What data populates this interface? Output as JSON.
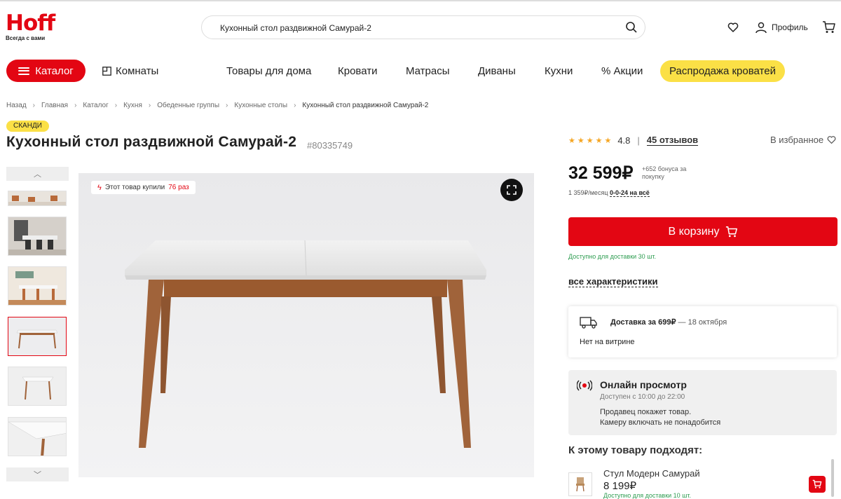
{
  "brand": {
    "logo": "Hoff",
    "tagline": "Всегда с вами",
    "accent": "#e30613",
    "yellow": "#fbe046"
  },
  "search": {
    "value": "Кухонный стол раздвижной Самурай-2",
    "icon": "search-icon"
  },
  "header": {
    "profile_label": "Профиль"
  },
  "nav": {
    "catalog": "Каталог",
    "rooms": "Комнаты",
    "items": [
      "Товары для дома",
      "Кровати",
      "Матрасы",
      "Диваны",
      "Кухни",
      "% Акции"
    ],
    "sale": "Распродажа кроватей"
  },
  "breadcrumb": [
    "Назад",
    "Главная",
    "Каталог",
    "Кухня",
    "Обеденные группы",
    "Кухонные столы",
    "Кухонный стол раздвижной Самурай-2"
  ],
  "product": {
    "badge": "СКАНДИ",
    "title": "Кухонный стол раздвижной Самурай-2",
    "sku": "#80335749",
    "rating": "4.8",
    "reviews": "45 отзывов",
    "favorite": "В избранное",
    "bought_prefix": "Этот товар купили",
    "bought_count": "76 раз"
  },
  "pricing": {
    "price": "32 599₽",
    "bonus": "+652 бонуса за покупку",
    "credit_prefix": "1 359₽/месяц",
    "credit_link": "0-0-24 на всё",
    "to_cart": "В корзину",
    "availability": "Доступно для доставки 30 шт.",
    "all_chars": "все характеристики"
  },
  "delivery": {
    "label": "Доставка за 699₽",
    "date": "— 18 октября",
    "showroom": "Нет на витрине"
  },
  "online_view": {
    "title": "Онлайн просмотр",
    "time": "Доступен с 10:00 до 22:00",
    "line1": "Продавец покажет товар.",
    "line2": "Камеру включать не понадобится"
  },
  "related": {
    "heading": "К этому товару подходят:",
    "items": [
      {
        "name": "Стул Модерн Самурай",
        "price": "8 199₽",
        "availability": "Доступно для доставки 10 шт."
      }
    ]
  }
}
